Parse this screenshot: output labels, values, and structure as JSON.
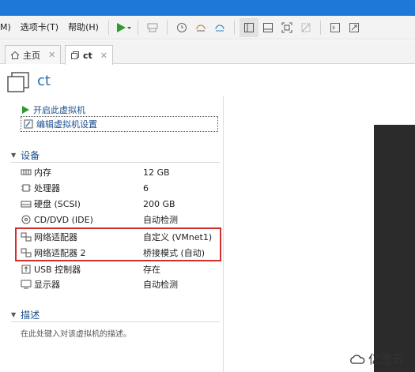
{
  "menu": {
    "items": [
      "M)",
      "选项卡(T)",
      "帮助(H)"
    ]
  },
  "tabs": [
    {
      "label": "主页"
    },
    {
      "label": "ct"
    }
  ],
  "vm": {
    "name": "ct"
  },
  "actions": {
    "power_on": "开启此虚拟机",
    "edit_settings": "编辑虚拟机设置"
  },
  "devices_section": {
    "title": "设备"
  },
  "devices": [
    {
      "name": "内存",
      "value": "12 GB",
      "icon": "memory-icon"
    },
    {
      "name": "处理器",
      "value": "6",
      "icon": "cpu-icon"
    },
    {
      "name": "硬盘 (SCSI)",
      "value": "200 GB",
      "icon": "harddisk-icon"
    },
    {
      "name": "CD/DVD (IDE)",
      "value": "自动检测",
      "icon": "cd-icon"
    },
    {
      "name": "网络适配器",
      "value": "自定义 (VMnet1)",
      "icon": "network-icon"
    },
    {
      "name": "网络适配器 2",
      "value": "桥接模式 (自动)",
      "icon": "network-icon"
    },
    {
      "name": "USB 控制器",
      "value": "存在",
      "icon": "usb-icon"
    },
    {
      "name": "显示器",
      "value": "自动检测",
      "icon": "display-icon"
    }
  ],
  "description_section": {
    "title": "描述",
    "placeholder": "在此处键入对该虚拟机的描述。"
  },
  "watermark": {
    "text": "亿速云"
  },
  "colors": {
    "titlebar": "#1e78d7",
    "link": "#1a4e8f",
    "highlight": "#d32f2f",
    "play": "#2e9b2e"
  }
}
